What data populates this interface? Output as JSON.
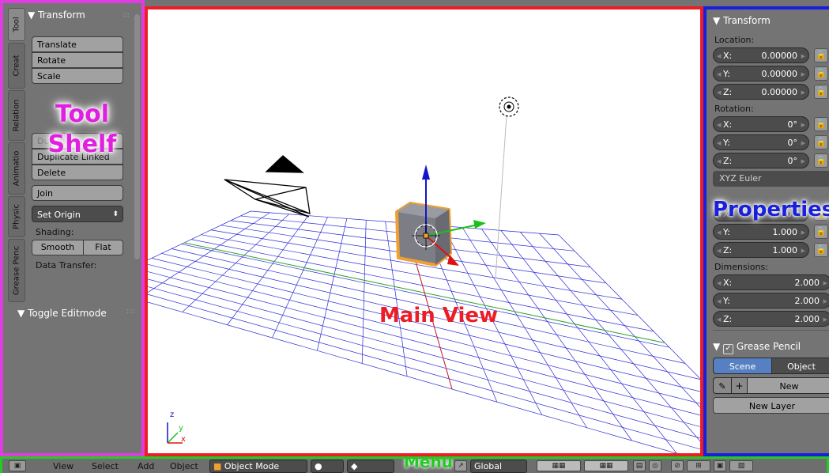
{
  "tool_shelf": {
    "tabs": [
      "Tool",
      "Creat",
      "Relation",
      "Animatio",
      "Physic",
      "Grease Penc"
    ],
    "panel_title": "Transform",
    "transform_buttons": [
      "Translate",
      "Rotate",
      "Scale"
    ],
    "edit_buttons": [
      "Duplicate",
      "Duplicate Linked",
      "Delete"
    ],
    "join_label": "Join",
    "set_origin_label": "Set Origin",
    "shading_label": "Shading:",
    "smooth_label": "Smooth",
    "flat_label": "Flat",
    "data_transfer_label": "Data Transfer:",
    "toggle_editmode_label": "Toggle Editmode",
    "overlay_label_line1": "Tool",
    "overlay_label_line2": "Shelf"
  },
  "main_view": {
    "overlay_label": "Main View",
    "axis_labels": {
      "z": "z",
      "y": "y",
      "x": "x"
    }
  },
  "properties": {
    "panel_title": "Transform",
    "location_label": "Location:",
    "location": [
      {
        "axis": "X:",
        "value": "0.00000"
      },
      {
        "axis": "Y:",
        "value": "0.00000"
      },
      {
        "axis": "Z:",
        "value": "0.00000"
      }
    ],
    "rotation_label": "Rotation:",
    "rotation": [
      {
        "axis": "X:",
        "value": "0°"
      },
      {
        "axis": "Y:",
        "value": "0°"
      },
      {
        "axis": "Z:",
        "value": "0°"
      }
    ],
    "rotation_mode": "XYZ Euler",
    "scale": [
      {
        "axis": "X:",
        "value": "1.000"
      },
      {
        "axis": "Y:",
        "value": "1.000"
      },
      {
        "axis": "Z:",
        "value": "1.000"
      }
    ],
    "dimensions_label": "Dimensions:",
    "dimensions": [
      {
        "axis": "X:",
        "value": "2.000"
      },
      {
        "axis": "Y:",
        "value": "2.000"
      },
      {
        "axis": "Z:",
        "value": "2.000"
      }
    ],
    "grease_pencil_title": "Grease Pencil",
    "scene_label": "Scene",
    "object_label": "Object",
    "new_label": "New",
    "new_layer_label": "New Layer",
    "overlay_label": "Properties"
  },
  "menu_bar": {
    "items": [
      "View",
      "Select",
      "Add",
      "Object"
    ],
    "mode": "Object Mode",
    "orientation": "Global",
    "overlay_label": "Menu"
  },
  "colors": {
    "tool_shelf_border": "#e13ce0",
    "main_view_border": "#ee1c24",
    "properties_border": "#1820dc",
    "menu_border": "#22cc22",
    "selected_object": "#f0a030",
    "active_tab": "#5680c2"
  }
}
